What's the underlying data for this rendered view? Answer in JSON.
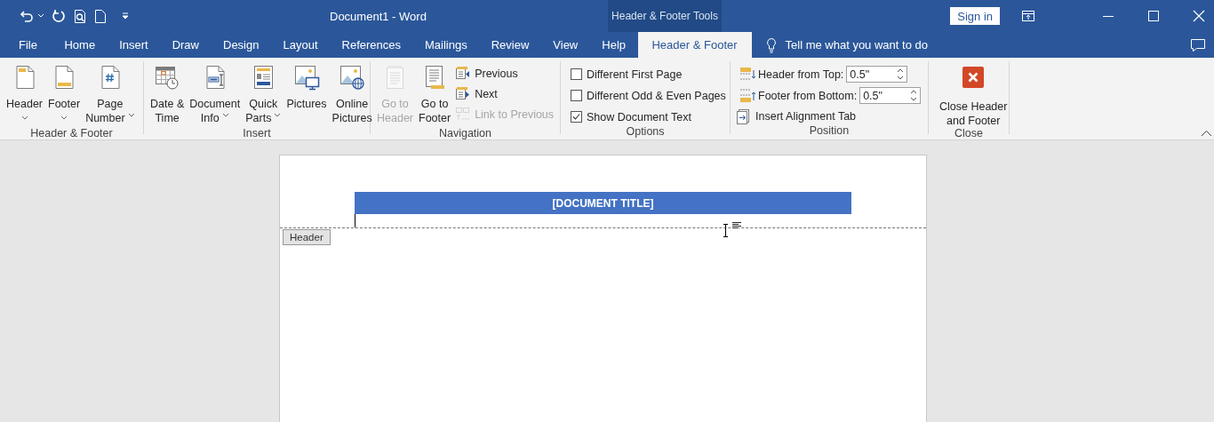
{
  "window": {
    "title": "Document1  -  Word",
    "context_label": "Header & Footer Tools",
    "sign_in": "Sign in"
  },
  "tabs": [
    {
      "label": "File",
      "selected": false
    },
    {
      "label": "Home",
      "selected": false
    },
    {
      "label": "Insert",
      "selected": false
    },
    {
      "label": "Draw",
      "selected": false
    },
    {
      "label": "Design",
      "selected": false
    },
    {
      "label": "Layout",
      "selected": false
    },
    {
      "label": "References",
      "selected": false
    },
    {
      "label": "Mailings",
      "selected": false
    },
    {
      "label": "Review",
      "selected": false
    },
    {
      "label": "View",
      "selected": false
    },
    {
      "label": "Help",
      "selected": false
    },
    {
      "label": "Header & Footer",
      "selected": true
    }
  ],
  "tell_me": "Tell me what you want to do",
  "ribbon_groups": [
    {
      "label": "Header & Footer",
      "items": [
        {
          "kind": "large",
          "lines": [
            "Header"
          ],
          "dropdown": true,
          "disabled": false
        },
        {
          "kind": "large",
          "lines": [
            "Footer"
          ],
          "dropdown": true,
          "disabled": false
        },
        {
          "kind": "large",
          "lines": [
            "Page",
            "Number"
          ],
          "dropdown": true,
          "disabled": false
        }
      ]
    },
    {
      "label": "Insert",
      "items": [
        {
          "kind": "large",
          "lines": [
            "Date &",
            "Time"
          ],
          "dropdown": false,
          "disabled": false
        },
        {
          "kind": "large",
          "lines": [
            "Document",
            "Info"
          ],
          "dropdown": true,
          "disabled": false
        },
        {
          "kind": "large",
          "lines": [
            "Quick",
            "Parts"
          ],
          "dropdown": true,
          "disabled": false
        },
        {
          "kind": "large",
          "lines": [
            "Pictures"
          ],
          "dropdown": false,
          "disabled": false
        },
        {
          "kind": "large",
          "lines": [
            "Online",
            "Pictures"
          ],
          "dropdown": false,
          "disabled": false
        }
      ]
    },
    {
      "label": "Navigation",
      "items": [
        {
          "kind": "large",
          "lines": [
            "Go to",
            "Header"
          ],
          "dropdown": false,
          "disabled": true
        },
        {
          "kind": "large",
          "lines": [
            "Go to",
            "Footer"
          ],
          "dropdown": false,
          "disabled": false
        },
        {
          "kind": "small",
          "label": "Previous",
          "disabled": false
        },
        {
          "kind": "small",
          "label": "Next",
          "disabled": false
        },
        {
          "kind": "small",
          "label": "Link to Previous",
          "disabled": true
        }
      ]
    },
    {
      "label": "Options",
      "items": [
        {
          "kind": "checkbox",
          "label": "Different First Page",
          "checked": false
        },
        {
          "kind": "checkbox",
          "label": "Different Odd & Even Pages",
          "checked": false
        },
        {
          "kind": "checkbox",
          "label": "Show Document Text",
          "checked": true
        }
      ]
    },
    {
      "label": "Position",
      "items": [
        {
          "kind": "spinner",
          "label": "Header from Top:",
          "value": "0.5\""
        },
        {
          "kind": "spinner",
          "label": "Footer from Bottom:",
          "value": "0.5\""
        },
        {
          "kind": "small",
          "label": "Insert Alignment Tab",
          "disabled": false
        }
      ]
    },
    {
      "label": "Close",
      "items": [
        {
          "kind": "close",
          "lines": [
            "Close Header",
            "and Footer"
          ]
        }
      ]
    }
  ],
  "document": {
    "header_title": "[DOCUMENT TITLE]",
    "header_tag": "Header"
  }
}
